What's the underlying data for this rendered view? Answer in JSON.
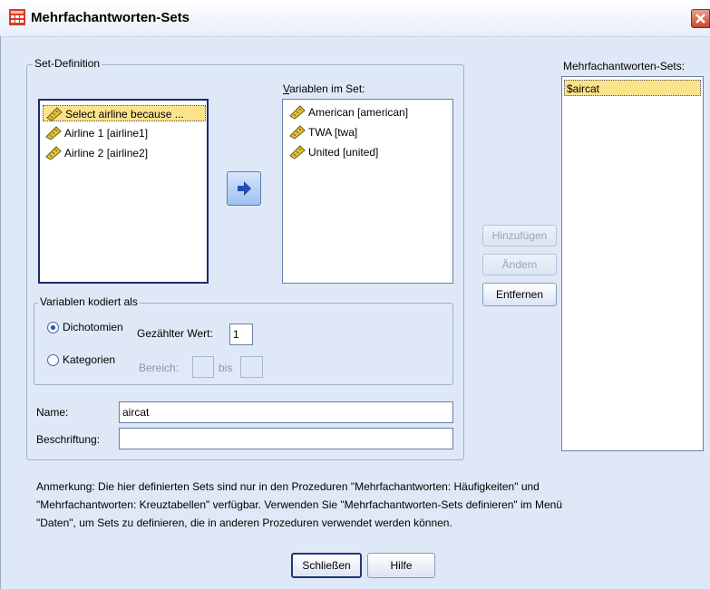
{
  "window": {
    "title": "Mehrfachantworten-Sets",
    "close_symbol": "X"
  },
  "set_definition": {
    "legend": "Set-Definition",
    "source_items": [
      {
        "label": "Select airline because ...",
        "icon": "ruler-icon",
        "selected": true
      },
      {
        "label": "Airline 1 [airline1]",
        "icon": "ruler-icon",
        "selected": false
      },
      {
        "label": "Airline 2 [airline2]",
        "icon": "ruler-icon",
        "selected": false
      }
    ],
    "move_button_icon": "arrow-right-icon",
    "vars_in_set_label": "Variablen im Set:",
    "vars_in_set": [
      {
        "label": "American [american]",
        "icon": "ruler-icon"
      },
      {
        "label": "TWA [twa]",
        "icon": "ruler-icon"
      },
      {
        "label": "United [united]",
        "icon": "ruler-icon"
      }
    ],
    "coded_as": {
      "legend": "Variablen kodiert als",
      "dichotomies_label": "Dichotomien",
      "dichotomies_checked": true,
      "counted_value_label": "Gezählter Wert:",
      "counted_value": "1",
      "categories_label": "Kategorien",
      "categories_checked": false,
      "range_label": "Bereich:",
      "range_to_label": "bis",
      "range_from_value": "",
      "range_to_value": ""
    },
    "name_label": "Name:",
    "name_value": "aircat",
    "label_label": "Beschriftung:",
    "label_value": ""
  },
  "actions": {
    "add": "Hinzufügen",
    "change": "Ändern",
    "remove": "Entfernen"
  },
  "sets_panel": {
    "label": "Mehrfachantworten-Sets:",
    "items": [
      "$aircat"
    ]
  },
  "note": {
    "line1": "Anmerkung: Die hier definierten Sets sind nur in den Prozeduren \"Mehrfachantworten: Häufigkeiten\" und",
    "line2": "\"Mehrfachantworten: Kreuztabellen\" verfügbar. Verwenden Sie \"Mehrfachantworten-Sets definieren\" im Menü",
    "line3": "\"Daten\", um Sets zu definieren, die in anderen Prozeduren verwendet werden können."
  },
  "footer": {
    "close": "Schließen",
    "help": "Hilfe"
  },
  "colors": {
    "background": "#dfe8f6",
    "selection": "#fbe38c",
    "listbox_border": "#1a2a78"
  }
}
